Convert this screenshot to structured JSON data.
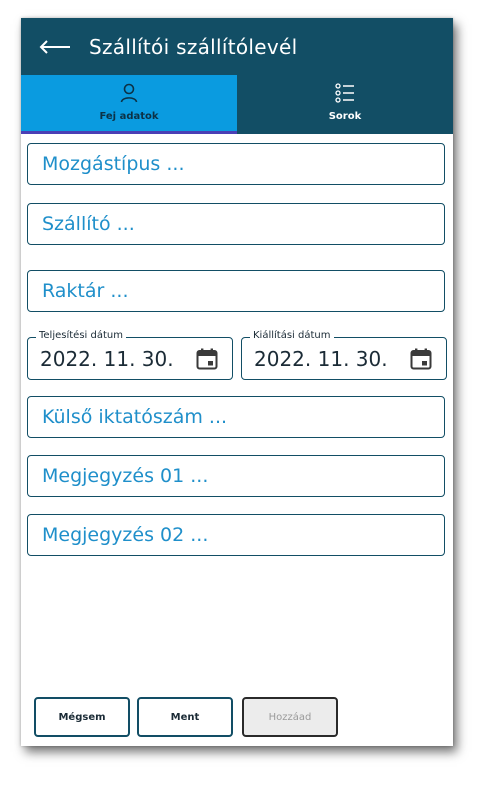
{
  "appbar": {
    "title": "Szállítói szállítólevél",
    "back_icon": "arrow-left-icon"
  },
  "tabs": [
    {
      "label": "Fej adatok",
      "icon": "user-icon",
      "active": true
    },
    {
      "label": "Sorok",
      "icon": "list-icon",
      "active": false
    }
  ],
  "fields": {
    "mozgastipus": "Mozgástípus ...",
    "szallito": "Szállító ...",
    "raktar": "Raktár ...",
    "kulso": "Külső iktatószám ...",
    "megj1": "Megjegyzés 01 ...",
    "megj2": "Megjegyzés 02 ..."
  },
  "dates": {
    "teljesitesi": {
      "label": "Teljesítési dátum",
      "value": "2022. 11. 30."
    },
    "kiallitasi": {
      "label": "Kiállítási dátum",
      "value": "2022. 11. 30."
    }
  },
  "buttons": {
    "cancel": "Mégsem",
    "save": "Ment",
    "add": "Hozzáad"
  },
  "colors": {
    "header": "#124e65",
    "active_tab": "#0a9be0",
    "placeholder": "#1f8fca"
  }
}
